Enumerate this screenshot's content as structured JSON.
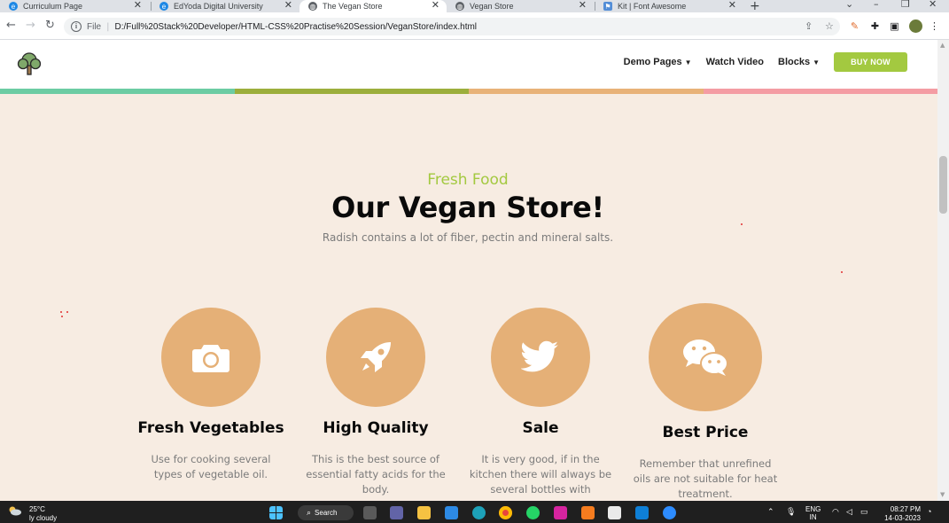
{
  "browser": {
    "tabs": [
      {
        "title": "Curriculum Page",
        "active": false
      },
      {
        "title": "EdYoda Digital University",
        "active": false
      },
      {
        "title": "The Vegan Store",
        "active": true
      },
      {
        "title": "Vegan Store",
        "active": false
      },
      {
        "title": "Kit | Font Awesome",
        "active": false
      }
    ],
    "new_tab_glyph": "+",
    "close_glyph": "✕",
    "scheme": "File",
    "url": "D:/Full%20Stack%20Developer/HTML-CSS%20Practise%20Session/VeganStore/index.html"
  },
  "site": {
    "nav": {
      "items": [
        {
          "label": "Demo Pages",
          "has_caret": true
        },
        {
          "label": "Watch Video",
          "has_caret": false
        },
        {
          "label": "Blocks",
          "has_caret": true
        }
      ],
      "cta": "BUY NOW",
      "caret": "▼"
    },
    "colorbar": [
      "#6ccca3",
      "#9cae3c",
      "#e8b278",
      "#f49ca3"
    ],
    "section": {
      "subtitle": "Fresh Food",
      "title": "Our Vegan Store!",
      "lead": "Radish contains a lot of fiber, pectin and mineral salts."
    },
    "features": [
      {
        "icon": "camera-icon",
        "title": "Fresh Vegetables",
        "text": "Use for cooking several types of vegetable oil."
      },
      {
        "icon": "rocket-icon",
        "title": "High Quality",
        "text": "This is the best source of essential fatty acids for the body."
      },
      {
        "icon": "twitter-icon",
        "title": "Sale",
        "text": "It is very good, if in the kitchen there will always be several bottles with"
      },
      {
        "icon": "wechat-icon",
        "title": "Best Price",
        "text": "Remember that unrefined oils are not suitable for heat treatment."
      }
    ],
    "accent_color": "#a3c940",
    "circle_color": "#e5b077"
  },
  "taskbar": {
    "weather_temp": "25°C",
    "weather_desc": "ly cloudy",
    "search_label": "Search",
    "lang_line1": "ENG",
    "lang_line2": "IN",
    "time": "08:27 PM",
    "date": "14-03-2023"
  }
}
